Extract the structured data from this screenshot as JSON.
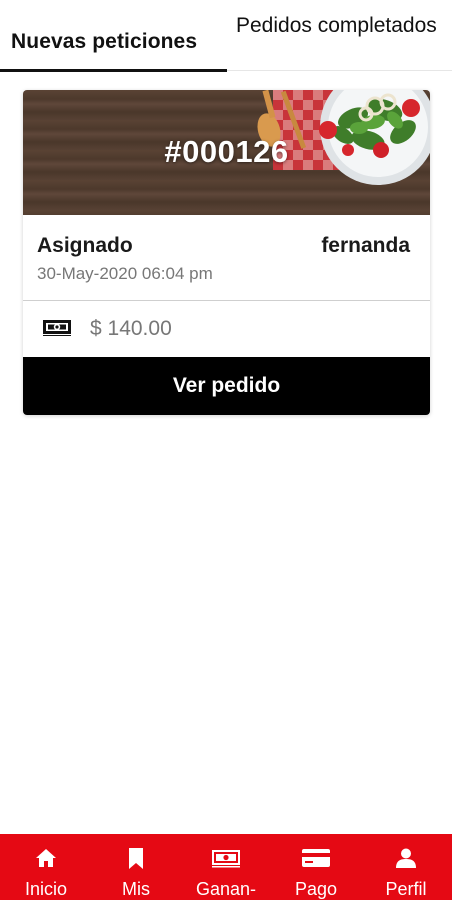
{
  "tabs": {
    "new": "Nuevas peticiones",
    "completed": "Pedidos completados"
  },
  "order": {
    "id": "#000126",
    "status": "Asignado",
    "customer": "fernanda",
    "datetime": "30-May-2020 06:04 pm",
    "amount": "$ 140.00",
    "amount_icon": "cash-icon",
    "action_label": "Ver pedido"
  },
  "nav": {
    "items": [
      {
        "label": "Inicio",
        "icon": "home-icon"
      },
      {
        "label": "Mis",
        "icon": "bookmark-icon"
      },
      {
        "label": "Ganan-",
        "icon": "cash-icon"
      },
      {
        "label": "Pago",
        "icon": "card-icon"
      },
      {
        "label": "Perfil",
        "icon": "person-icon"
      }
    ]
  },
  "colors": {
    "brand": "#e50914",
    "button": "#000000",
    "tab_indicator": "#111111"
  }
}
